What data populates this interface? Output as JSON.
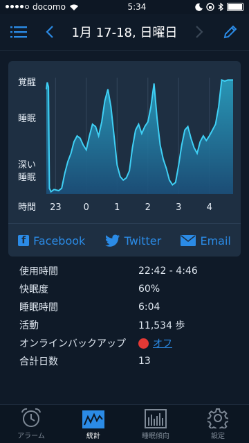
{
  "status_bar": {
    "carrier": "docomo",
    "time": "5:34"
  },
  "nav": {
    "title": "1月 17-18, 日曜日"
  },
  "chart_data": {
    "type": "area",
    "y_levels": [
      "覚醒",
      "睡眠",
      "深い\n睡眠"
    ],
    "y_label_awake": "覚醒",
    "y_label_sleep": "睡眠",
    "y_label_deep_1": "深い",
    "y_label_deep_2": "睡眠",
    "x_title": "時間",
    "x_ticks": [
      "23",
      "0",
      "1",
      "2",
      "3",
      "4"
    ],
    "x_range": [
      22.7,
      28.77
    ],
    "y_range": [
      0,
      1
    ],
    "grid": true,
    "x": [
      22.7,
      22.73,
      22.77,
      22.8,
      22.85,
      22.95,
      23.1,
      23.2,
      23.3,
      23.4,
      23.5,
      23.6,
      23.7,
      23.8,
      23.9,
      24.0,
      24.1,
      24.2,
      24.3,
      24.4,
      24.5,
      24.6,
      24.7,
      24.8,
      24.9,
      25.0,
      25.1,
      25.2,
      25.3,
      25.4,
      25.5,
      25.6,
      25.7,
      25.8,
      25.9,
      26.0,
      26.1,
      26.2,
      26.3,
      26.4,
      26.5,
      26.6,
      26.7,
      26.8,
      26.9,
      27.0,
      27.1,
      27.2,
      27.3,
      27.4,
      27.5,
      27.6,
      27.7,
      27.8,
      27.9,
      28.0,
      28.1,
      28.2,
      28.3,
      28.4,
      28.5,
      28.6,
      28.7,
      28.77
    ],
    "values": [
      0.9,
      0.96,
      0.92,
      0.05,
      0.02,
      0.04,
      0.03,
      0.05,
      0.18,
      0.28,
      0.35,
      0.45,
      0.5,
      0.48,
      0.42,
      0.38,
      0.5,
      0.6,
      0.58,
      0.5,
      0.62,
      0.8,
      0.9,
      0.75,
      0.5,
      0.25,
      0.15,
      0.12,
      0.14,
      0.2,
      0.4,
      0.55,
      0.6,
      0.52,
      0.58,
      0.62,
      0.75,
      0.95,
      0.65,
      0.42,
      0.3,
      0.22,
      0.12,
      0.08,
      0.1,
      0.25,
      0.42,
      0.55,
      0.58,
      0.48,
      0.4,
      0.35,
      0.45,
      0.5,
      0.46,
      0.5,
      0.55,
      0.6,
      0.75,
      0.98,
      0.97,
      0.98,
      0.98,
      0.98
    ]
  },
  "share": {
    "facebook": "Facebook",
    "twitter": "Twitter",
    "email": "Email"
  },
  "stats": [
    {
      "label": "使用時間",
      "value": "22:42 - 4:46"
    },
    {
      "label": "快眠度",
      "value": "60%"
    },
    {
      "label": "睡眠時間",
      "value": "6:04"
    },
    {
      "label": "活動",
      "value": "11,534 歩"
    },
    {
      "label": "オンラインバックアップ",
      "value": "オフ"
    },
    {
      "label": "合計日数",
      "value": "13"
    }
  ],
  "tabs": [
    {
      "label": "アラーム",
      "icon": "alarm-clock-icon"
    },
    {
      "label": "統計",
      "icon": "stats-chart-icon"
    },
    {
      "label": "睡眠傾向",
      "icon": "sleep-trend-icon"
    },
    {
      "label": "設定",
      "icon": "gear-icon"
    }
  ],
  "colors": {
    "accent": "#2b8be6",
    "chart_line": "#35c4f0",
    "background": "#0f1a28",
    "card": "#1e2f42"
  }
}
